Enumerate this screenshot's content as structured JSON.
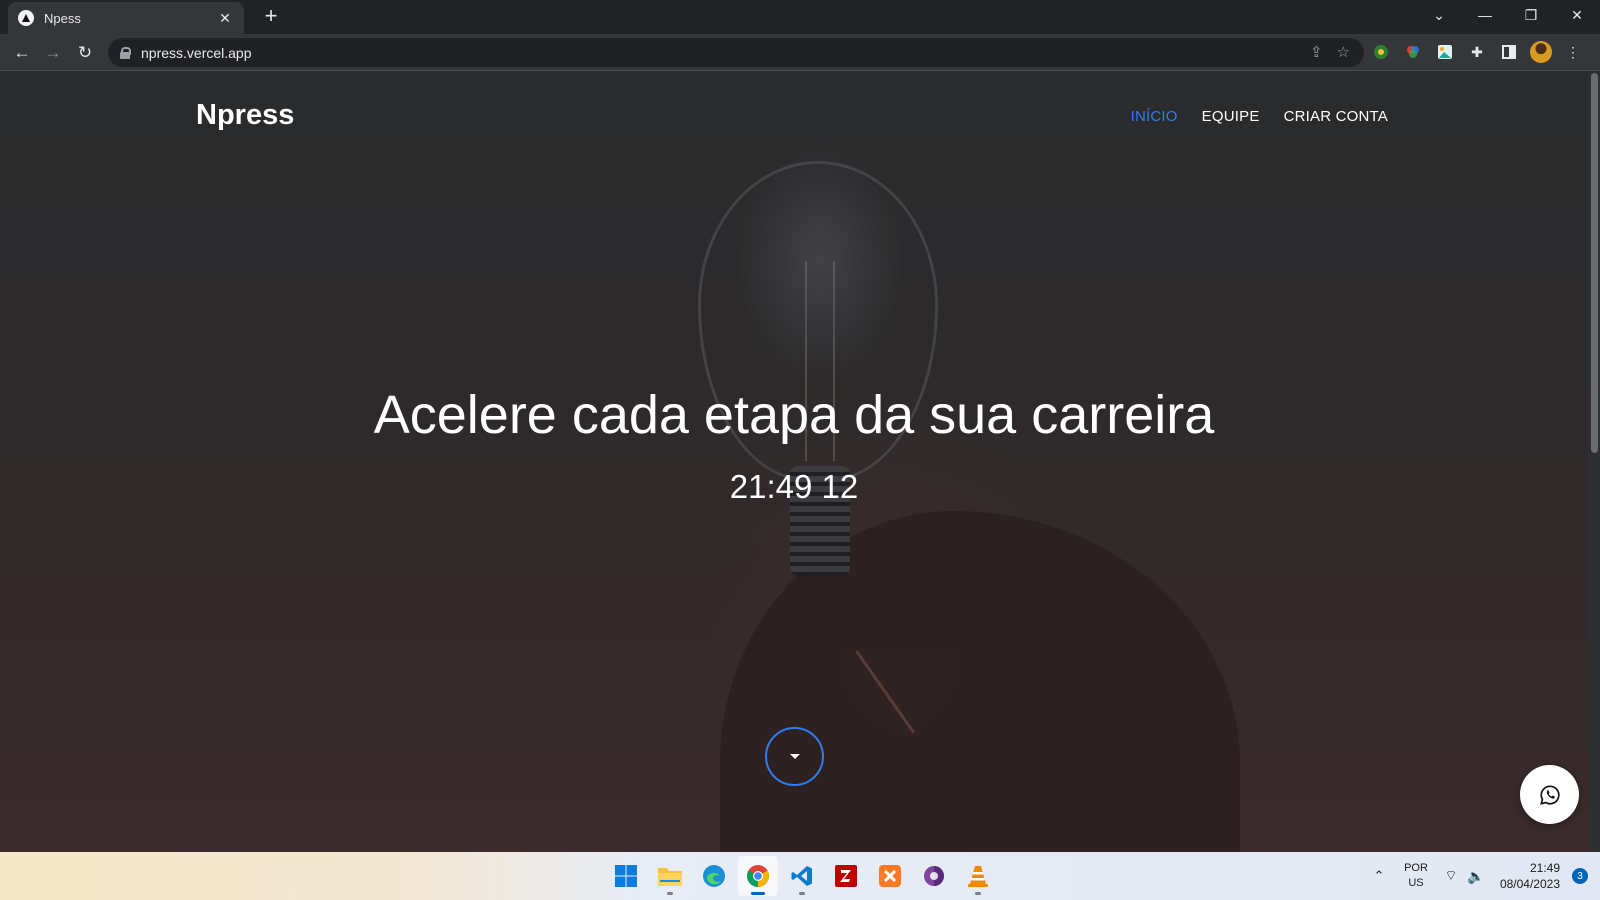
{
  "browser": {
    "tab": {
      "title": "Npess"
    },
    "address": {
      "url": "npress.vercel.app"
    }
  },
  "site": {
    "brand": "Npress",
    "nav": [
      {
        "label": "INÍCIO",
        "active": true
      },
      {
        "label": "EQUIPE",
        "active": false
      },
      {
        "label": "CRIAR CONTA",
        "active": false
      }
    ],
    "hero": {
      "title": "Acelere cada etapa da sua carreira",
      "clock": "21:49 12"
    },
    "colors": {
      "accent": "#2f7ef0",
      "text": "#ffffff"
    }
  },
  "taskbar": {
    "apps": [
      "windows-start",
      "file-explorer",
      "edge",
      "chrome",
      "vscode",
      "filezilla",
      "xampp",
      "tor-browser",
      "vlc"
    ],
    "active_app": "chrome",
    "language": {
      "line1": "POR",
      "line2": "US"
    },
    "time": "21:49",
    "date": "08/04/2023",
    "notifications": "3"
  }
}
